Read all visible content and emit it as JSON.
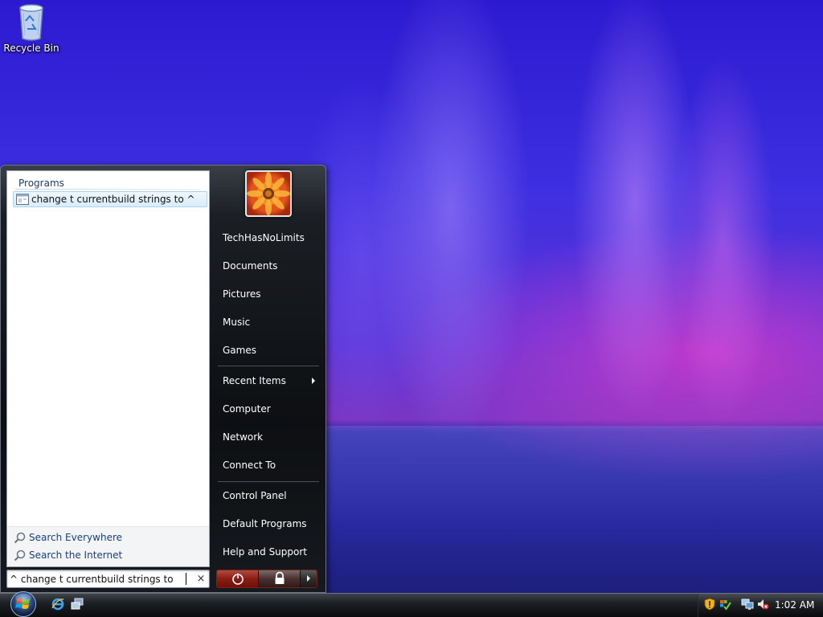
{
  "desktop": {
    "icons": [
      {
        "label": "Recycle Bin",
        "icon": "recycle-bin-icon"
      }
    ]
  },
  "start_menu": {
    "left_pane": {
      "section_header": "Programs",
      "results": [
        {
          "label": "change t currentbuild strings to ^",
          "icon": "program-window-icon"
        }
      ],
      "search_links": [
        {
          "label": "Search Everywhere",
          "icon": "magnifier-icon"
        },
        {
          "label": "Search the Internet",
          "icon": "magnifier-icon"
        }
      ]
    },
    "search_box": {
      "value": "change t currentbuild strings to ^",
      "clear_icon": "×"
    },
    "right_pane": {
      "user_name": "TechHasNoLimits",
      "items": [
        {
          "label": "Documents"
        },
        {
          "label": "Pictures"
        },
        {
          "label": "Music"
        },
        {
          "label": "Games"
        },
        {
          "label": "Recent Items",
          "has_submenu": true
        },
        {
          "label": "Computer"
        },
        {
          "label": "Network"
        },
        {
          "label": "Connect To"
        },
        {
          "label": "Control Panel"
        },
        {
          "label": "Default Programs"
        },
        {
          "label": "Help and Support"
        }
      ]
    },
    "power_buttons": [
      "power-icon",
      "lock-icon",
      "arrow-icon"
    ]
  },
  "taskbar": {
    "quick_launch": [
      "internet-explorer-icon",
      "switch-windows-icon"
    ],
    "tray_icons": [
      "security-shield-icon",
      "windows-update-icon",
      "network-icon",
      "volume-muted-icon"
    ],
    "clock": "1:02 AM"
  },
  "colors": {
    "accent_blue": "#3d2fe0",
    "accent_magenta": "#dc3cc8",
    "menu_dark": "#0d0f12",
    "power_red": "#8a1e14"
  }
}
